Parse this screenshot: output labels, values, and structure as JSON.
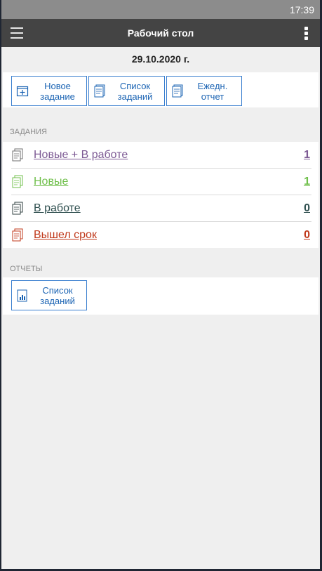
{
  "status_bar": {
    "time": "17:39"
  },
  "app_bar": {
    "title": "Рабочий стол"
  },
  "date": "29.10.2020 г.",
  "quick_actions": [
    {
      "label": "Новое\nзадание",
      "icon": "new-task-icon"
    },
    {
      "label": "Список\nзаданий",
      "icon": "task-list-icon"
    },
    {
      "label": "Ежедн.\nотчет",
      "icon": "daily-report-icon"
    }
  ],
  "tasks_section": {
    "header": "ЗАДАНИЯ",
    "items": [
      {
        "label": "Новые + В работе",
        "count": "1",
        "color": "#7d5a94",
        "icon": "document-icon"
      },
      {
        "label": "Новые",
        "count": "1",
        "color": "#6fbf4a",
        "icon": "document-icon"
      },
      {
        "label": "В работе",
        "count": "0",
        "color": "#2f4f4f",
        "icon": "document-icon"
      },
      {
        "label": "Вышел срок",
        "count": "0",
        "color": "#c0391b",
        "icon": "document-icon"
      }
    ]
  },
  "reports_section": {
    "header": "ОТЧЕТЫ",
    "items": [
      {
        "label": "Список\nзаданий",
        "icon": "report-chart-icon"
      }
    ]
  },
  "colors": {
    "accent": "#3a7fcf",
    "app_bar": "#444444",
    "status_bar": "#8c8c8c"
  }
}
